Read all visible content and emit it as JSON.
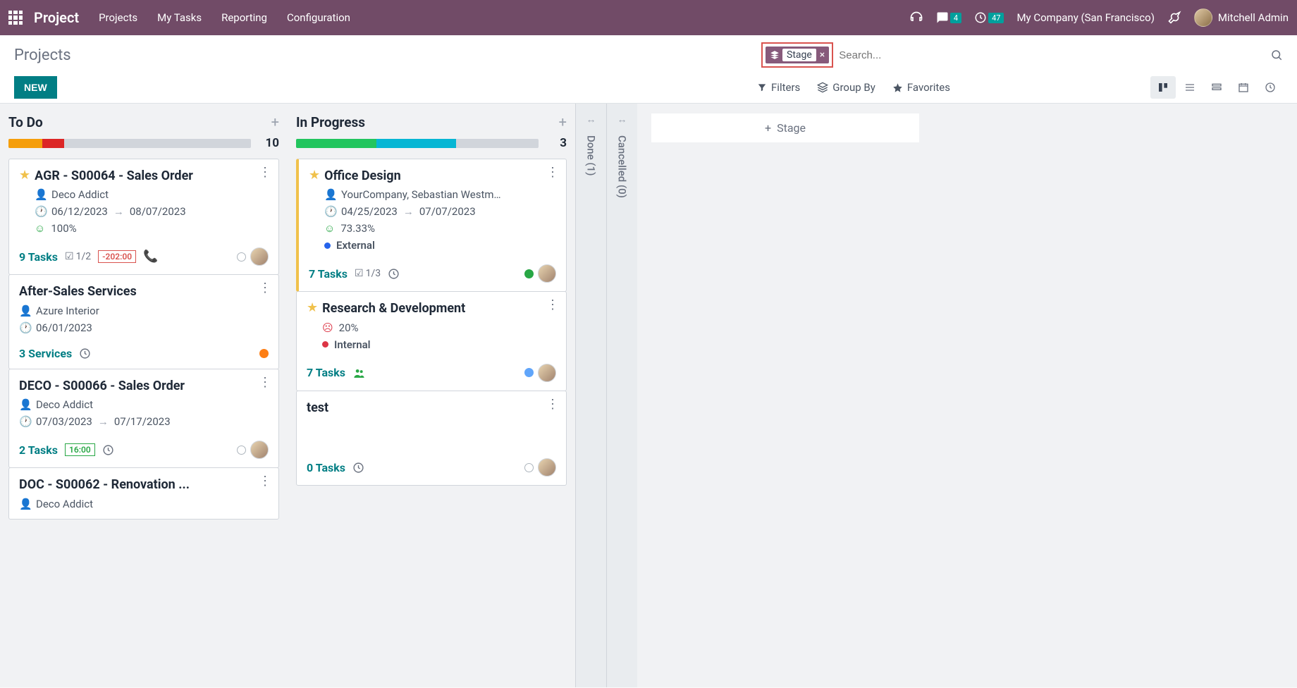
{
  "nav": {
    "brand": "Project",
    "menu": [
      "Projects",
      "My Tasks",
      "Reporting",
      "Configuration"
    ],
    "messages_badge": "4",
    "activities_badge": "47",
    "company": "My Company (San Francisco)",
    "user": "Mitchell Admin"
  },
  "page": {
    "title": "Projects",
    "new_btn": "NEW",
    "search_tag": "Stage",
    "search_placeholder": "Search...",
    "filters": "Filters",
    "groupby": "Group By",
    "favorites": "Favorites"
  },
  "columns": {
    "todo": {
      "title": "To Do",
      "count": "10",
      "segments": [
        {
          "w": "14%",
          "c": "#f59e0b"
        },
        {
          "w": "9%",
          "c": "#dc2626"
        }
      ],
      "cards": [
        {
          "star": true,
          "title": "AGR - S00064 - Sales Order",
          "partner": "Deco Addict",
          "date1": "06/12/2023",
          "date2": "08/07/2023",
          "smile": "good",
          "pct": "100%",
          "tasks": "9 Tasks",
          "check": "1/2",
          "time": "-202:00",
          "time_style": "red",
          "phone": true,
          "status": "empty",
          "avatar": true
        },
        {
          "star": false,
          "title": "After-Sales Services",
          "partner": "Azure Interior",
          "date1": "06/01/2023",
          "tasks": "3 Services",
          "clock": true,
          "status": "orange"
        },
        {
          "star": false,
          "title": "DECO - S00066 - Sales Order",
          "partner": "Deco Addict",
          "date1": "07/03/2023",
          "date2": "07/17/2023",
          "tasks": "2 Tasks",
          "time": "16:00",
          "time_style": "green",
          "clock": true,
          "status": "empty",
          "avatar": true
        },
        {
          "star": false,
          "title": "DOC - S00062 - Renovation ...",
          "partner": "Deco Addict"
        }
      ]
    },
    "inprogress": {
      "title": "In Progress",
      "count": "3",
      "segments": [
        {
          "w": "33%",
          "c": "#22c55e"
        },
        {
          "w": "33%",
          "c": "#06b6d4"
        }
      ],
      "cards": [
        {
          "star": true,
          "side": true,
          "title": "Office Design",
          "partner": "YourCompany, Sebastian Westm…",
          "date1": "04/25/2023",
          "date2": "07/07/2023",
          "smile": "good",
          "pct": "73.33%",
          "tag": "External",
          "tagdot": "blue",
          "tasks": "7 Tasks",
          "check": "1/3",
          "clock": true,
          "status": "green",
          "avatar": true
        },
        {
          "star": true,
          "title": "Research & Development",
          "smile": "bad",
          "pct": "20%",
          "tag": "Internal",
          "tagdot": "red",
          "tasks": "7 Tasks",
          "group": true,
          "status": "blue",
          "avatar": true
        },
        {
          "star": false,
          "title": "test",
          "tasks": "0 Tasks",
          "clock": true,
          "status": "empty",
          "avatar": true
        }
      ]
    },
    "done": {
      "title": "Done (1)"
    },
    "cancelled": {
      "title": "Cancelled (0)"
    },
    "add_stage": "Stage"
  }
}
